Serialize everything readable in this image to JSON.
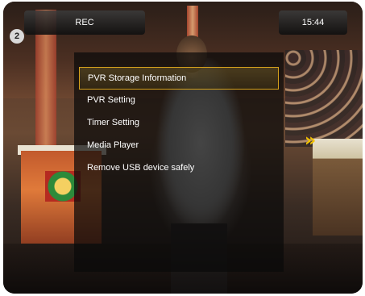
{
  "osd": {
    "title": "REC",
    "time": "15:44",
    "channel_badge": "2"
  },
  "menu": {
    "selected_index": 0,
    "items": [
      {
        "label": "PVR Storage Information"
      },
      {
        "label": "PVR Setting"
      },
      {
        "label": "Timer Setting"
      },
      {
        "label": "Media Player"
      },
      {
        "label": "Remove USB device safely"
      }
    ]
  },
  "colors": {
    "highlight_border": "#d6a21c",
    "text": "#ffffff",
    "panel": "rgba(10,10,10,0.72)"
  }
}
